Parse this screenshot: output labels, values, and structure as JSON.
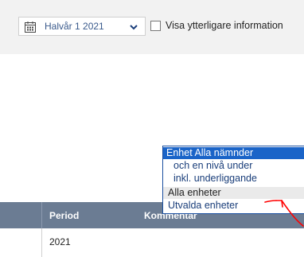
{
  "toolbar": {
    "period_label": "Halvår 1 2021",
    "checkbox_label": "Visa ytterligare information",
    "checkbox_checked": false
  },
  "dropdown": {
    "items": [
      "Enhet Alla nämnder",
      "och en nivå under",
      "inkl. underliggande",
      "Alla enheter",
      "Utvalda enheter"
    ],
    "selected_index": 0
  },
  "table": {
    "columns": [
      "Period",
      "Kommentar"
    ],
    "rows": [
      [
        "2021"
      ]
    ]
  },
  "colors": {
    "header_bg": "#6b7c93",
    "selection_bg": "#1a64c8",
    "annotation": "#ff0000"
  },
  "icons": {
    "period_select": "calendar-icon",
    "select_arrow": "chevron-down-icon"
  }
}
